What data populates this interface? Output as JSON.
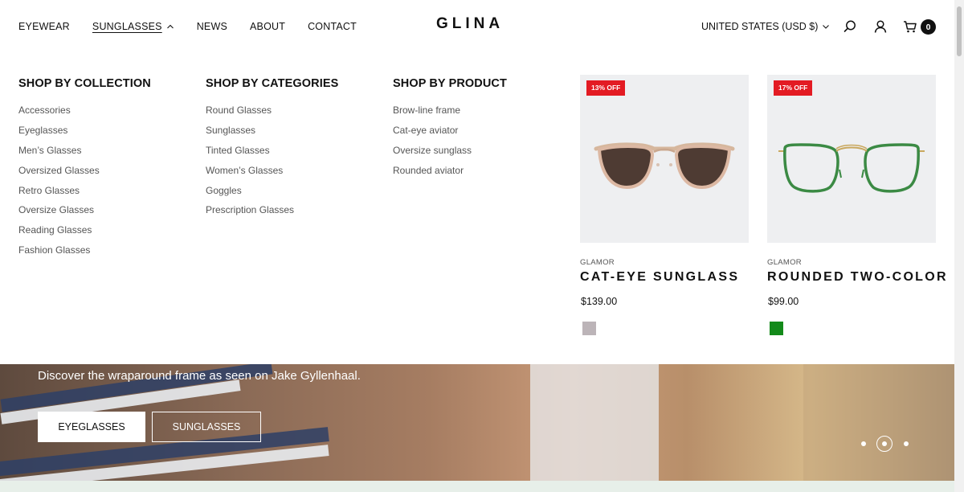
{
  "header": {
    "nav": [
      {
        "label": "EYEWEAR"
      },
      {
        "label": "SUNGLASSES"
      },
      {
        "label": "NEWS"
      },
      {
        "label": "ABOUT"
      },
      {
        "label": "CONTACT"
      }
    ],
    "logo": "GLINA",
    "currency": "UNITED STATES (USD $)",
    "cart_count": "0"
  },
  "menu": {
    "columns": [
      {
        "title": "SHOP BY COLLECTION",
        "items": [
          "Accessories",
          "Eyeglasses",
          "Men’s Glasses",
          "Oversized Glasses",
          "Retro Glasses",
          "Oversize Glasses",
          "Reading Glasses",
          "Fashion Glasses"
        ]
      },
      {
        "title": "SHOP BY CATEGORIES",
        "items": [
          "Round Glasses",
          "Sunglasses",
          "Tinted Glasses",
          "Women’s Glasses",
          "Goggles",
          "Prescription Glasses"
        ]
      },
      {
        "title": "SHOP BY PRODUCT",
        "items": [
          "Brow-line frame",
          "Cat-eye aviator",
          "Oversize sunglass",
          "Rounded aviator"
        ]
      }
    ],
    "products": [
      {
        "badge": "13% OFF",
        "brand": "GLAMOR",
        "name": "CAT-EYE SUNGLASS",
        "price": "$139.00",
        "swatch": "#bcb4b8"
      },
      {
        "badge": "17% OFF",
        "brand": "GLAMOR",
        "name": "ROUNDED TWO-COLOR",
        "price": "$99.00",
        "swatch": "#138a1a"
      }
    ]
  },
  "hero": {
    "text": "Discover the wraparound frame as seen on Jake Gyllenhaal.",
    "buttons": [
      "EYEGLASSES",
      "SUNGLASSES"
    ],
    "slides": 3,
    "active_slide": 2
  },
  "colors": {
    "badge": "#e31b23",
    "text": "#111111",
    "muted": "#555555"
  }
}
